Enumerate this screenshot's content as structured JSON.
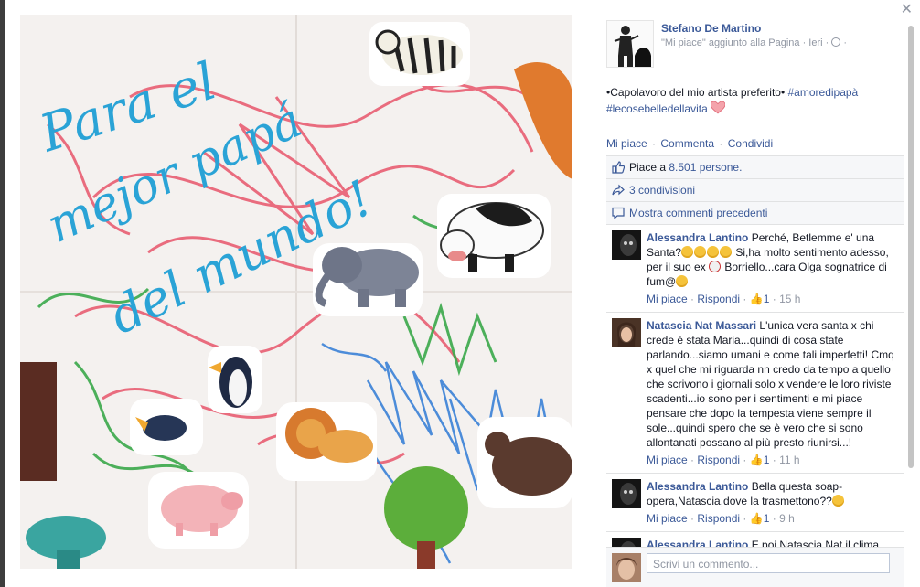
{
  "header": {
    "page_name": "Stefano De Martino",
    "subtitle": "\"Mi piace\" aggiunto alla Pagina · Ieri · ",
    "subtitle_tail": "·"
  },
  "post": {
    "text_plain": "•Capolavoro del mio artista preferito• ",
    "hashtag1": "#amoredipapà",
    "hashtag2": "#lecosebelledellavita"
  },
  "photo": {
    "drawing_text_line1": "Para el",
    "drawing_text_line2": "mejor papá",
    "drawing_text_line3": "del mundo!"
  },
  "actions": {
    "like": "Mi piace",
    "comment": "Commenta",
    "share": "Condividi",
    "separator": "·"
  },
  "ufi": {
    "likes_prefix": "Piace a ",
    "likes_count": "8.501 persone.",
    "shares": "3 condivisioni",
    "previous_comments": "Mostra commenti precedenti"
  },
  "comments": [
    {
      "author": "Alessandra Lantino",
      "text_a": " Perché, Betlemme e' una Santa?",
      "text_b": " Si,ha molto sentimento adesso, per il suo ex ",
      "text_c": " Borriello...cara Olga sognatrice di fum@",
      "like": "Mi piace",
      "reply": "Rispondi",
      "likes": "1",
      "time": "15 h"
    },
    {
      "author": "Natascia Nat Massari",
      "text_a": " L'unica vera santa x chi crede è stata Maria...quindi di cosa state parlando...siamo umani e come tali imperfetti! Cmq x quel che mi riguarda nn credo da tempo a quello che scrivono i giornali solo x vendere le loro riviste scadenti...io sono per i sentimenti e mi piace pensare che dopo la tempesta viene sempre il sole...quindi spero che se è vero che si sono allontanati possano al più presto riunirsi...!",
      "like": "Mi piace",
      "reply": "Rispondi",
      "likes": "1",
      "time": "11 h"
    },
    {
      "author": "Alessandra Lantino",
      "text_a": " Bella questa soap-opera,Natascia,dove la trasmettono??",
      "like": "Mi piace",
      "reply": "Rispondi",
      "likes": "1",
      "time": "9 h"
    },
    {
      "author": "Alessandra Lantino",
      "text_a": " E poi,Natascia Nat,il clima non è più quello di una volta! Dopo la"
    }
  ],
  "composer": {
    "placeholder": "Scrivi un commento..."
  },
  "colors": {
    "link": "#3b5998",
    "meta": "#9197a3",
    "panel": "#f6f7f9"
  }
}
